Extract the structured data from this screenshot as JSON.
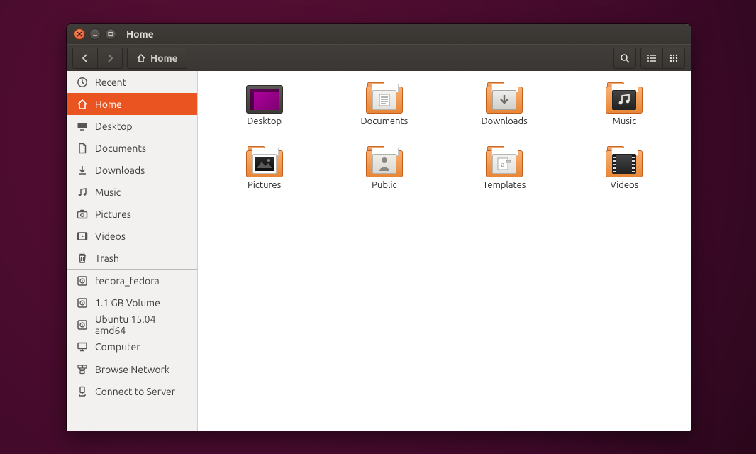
{
  "window": {
    "title": "Home"
  },
  "toolbar": {
    "path_label": "Home"
  },
  "sidebar": {
    "groups": [
      [
        {
          "icon": "clock",
          "label": "Recent",
          "active": false
        },
        {
          "icon": "home",
          "label": "Home",
          "active": true
        },
        {
          "icon": "desktop",
          "label": "Desktop",
          "active": false
        },
        {
          "icon": "doc",
          "label": "Documents",
          "active": false
        },
        {
          "icon": "download",
          "label": "Downloads",
          "active": false
        },
        {
          "icon": "music",
          "label": "Music",
          "active": false
        },
        {
          "icon": "camera",
          "label": "Pictures",
          "active": false
        },
        {
          "icon": "video",
          "label": "Videos",
          "active": false
        },
        {
          "icon": "trash",
          "label": "Trash",
          "active": false
        }
      ],
      [
        {
          "icon": "disk",
          "label": "fedora_fedora",
          "active": false
        },
        {
          "icon": "disk",
          "label": "1.1 GB Volume",
          "active": false
        },
        {
          "icon": "disk",
          "label": "Ubuntu 15.04 amd64",
          "active": false
        },
        {
          "icon": "computer",
          "label": "Computer",
          "active": false
        }
      ],
      [
        {
          "icon": "network",
          "label": "Browse Network",
          "active": false
        },
        {
          "icon": "server",
          "label": "Connect to Server",
          "active": false
        }
      ]
    ]
  },
  "folders": [
    {
      "name": "Desktop",
      "kind": "desktop"
    },
    {
      "name": "Documents",
      "kind": "documents"
    },
    {
      "name": "Downloads",
      "kind": "downloads"
    },
    {
      "name": "Music",
      "kind": "music"
    },
    {
      "name": "Pictures",
      "kind": "pictures"
    },
    {
      "name": "Public",
      "kind": "public"
    },
    {
      "name": "Templates",
      "kind": "templates"
    },
    {
      "name": "Videos",
      "kind": "videos"
    }
  ]
}
